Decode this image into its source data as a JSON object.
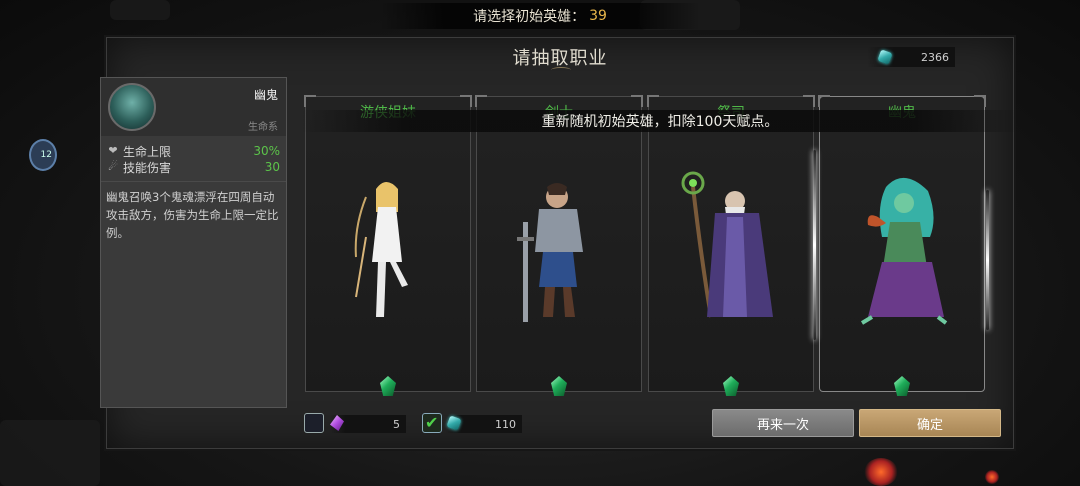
{
  "top_banner": {
    "text": "请选择初始英雄：",
    "count": "39"
  },
  "side_bubble": {
    "text": "12"
  },
  "panel": {
    "title": "请抽取职业"
  },
  "currency": {
    "icon": "teal-gem-icon",
    "amount": "2366"
  },
  "notice": "重新随机初始英雄，扣除100天赋点。",
  "cards": [
    {
      "name": "游侠姐妹",
      "icon": "green-gem-icon",
      "selected": false
    },
    {
      "name": "剑士",
      "icon": "green-gem-icon",
      "selected": false
    },
    {
      "name": "祭司",
      "icon": "green-gem-icon",
      "selected": false
    },
    {
      "name": "幽鬼",
      "icon": "green-gem-icon",
      "selected": true
    }
  ],
  "info": {
    "name": "幽鬼",
    "class": "生命系",
    "stats": [
      {
        "icon": "heart-icon",
        "label": "生命上限",
        "value": "30%"
      },
      {
        "icon": "skill-icon",
        "label": "技能伤害",
        "value": "30"
      }
    ],
    "description": "幽鬼召唤3个鬼魂漂浮在四周自动攻击敌方，伤害为生命上限一定比例。"
  },
  "options": [
    {
      "checked": false,
      "icon": "purple-gem-icon",
      "amount": "5"
    },
    {
      "checked": true,
      "icon": "teal-gem-icon",
      "amount": "110"
    }
  ],
  "buttons": {
    "retry": "再来一次",
    "confirm": "确定"
  },
  "colors": {
    "accent_green": "#4fb848",
    "confirm_gold": "#b8966a",
    "count_gold": "#e8b64a"
  }
}
